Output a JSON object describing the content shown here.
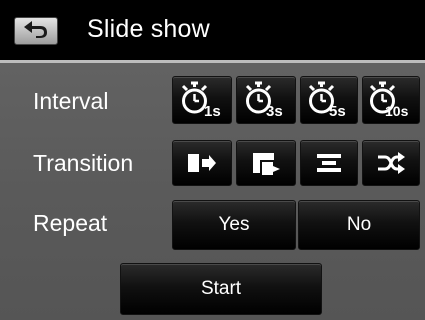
{
  "header": {
    "title": "Slide show",
    "back_icon": "return-arrow-icon"
  },
  "interval": {
    "label": "Interval",
    "options": [
      {
        "value": "1s",
        "icon": "timer-1s-icon"
      },
      {
        "value": "3s",
        "icon": "timer-3s-icon"
      },
      {
        "value": "5s",
        "icon": "timer-5s-icon"
      },
      {
        "value": "10s",
        "icon": "timer-10s-icon"
      }
    ]
  },
  "transition": {
    "label": "Transition",
    "options": [
      {
        "icon": "slide-in-icon"
      },
      {
        "icon": "corner-wipe-icon"
      },
      {
        "icon": "horizontal-bars-icon"
      },
      {
        "icon": "shuffle-icon"
      }
    ]
  },
  "repeat": {
    "label": "Repeat",
    "yes_label": "Yes",
    "no_label": "No"
  },
  "start_label": "Start",
  "colors": {
    "background": "#5d5d5d",
    "titlebar": "#000000",
    "button": "#111111",
    "text": "#ffffff"
  }
}
